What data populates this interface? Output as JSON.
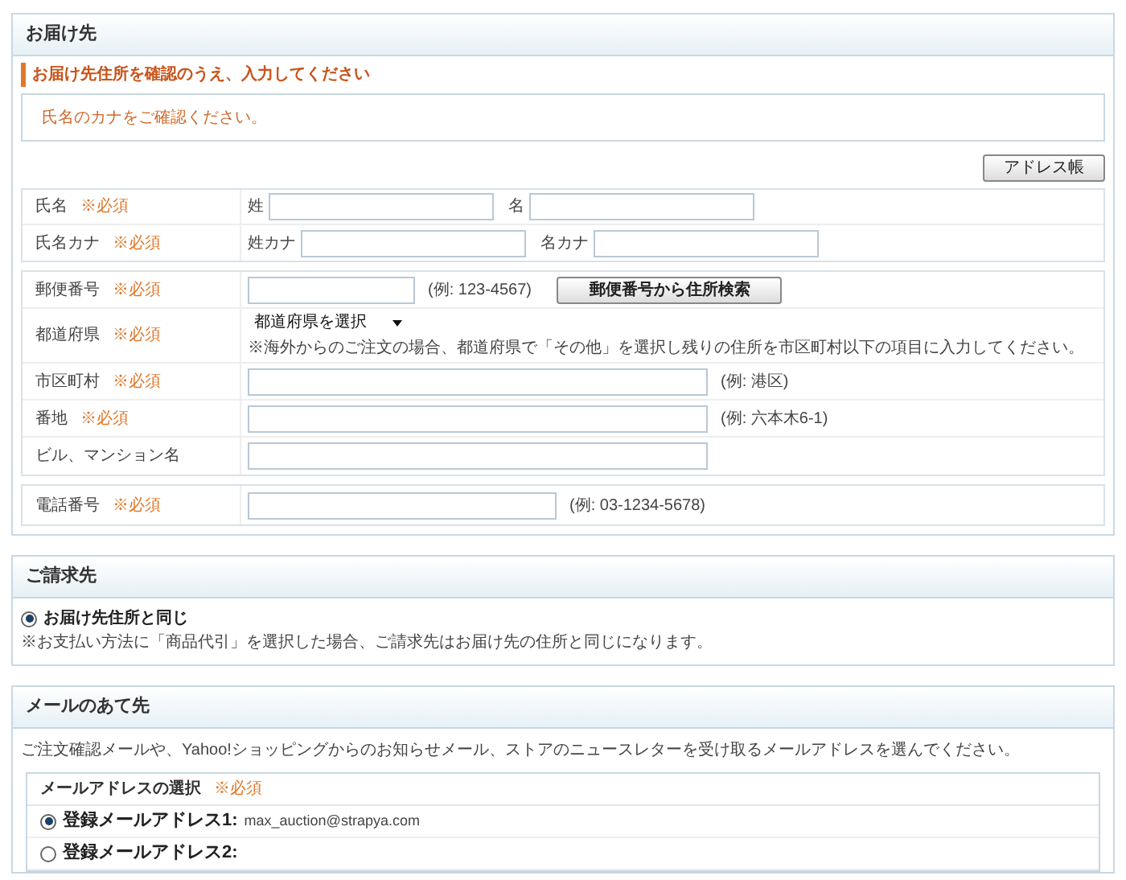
{
  "delivery": {
    "title": "お届け先",
    "instruction": "お届け先住所を確認のうえ、入力してください",
    "notice": "氏名のカナをご確認ください。",
    "address_book_button": "アドレス帳",
    "name_rows": [
      {
        "label": "氏名",
        "required": "※必須",
        "fields": [
          {
            "label": "姓"
          },
          {
            "label": "名"
          }
        ]
      },
      {
        "label": "氏名カナ",
        "required": "※必須",
        "fields": [
          {
            "label": "姓カナ"
          },
          {
            "label": "名カナ"
          }
        ]
      }
    ],
    "address_rows": [
      {
        "kind": "postal",
        "label": "郵便番号",
        "required": "※必須",
        "hint": "(例: 123-4567)",
        "button": "郵便番号から住所検索"
      },
      {
        "kind": "select",
        "label": "都道府県",
        "required": "※必須",
        "value": "都道府県を選択",
        "note": "※海外からのご注文の場合、都道府県で「その他」を選択し残りの住所を市区町村以下の項目に入力してください。"
      },
      {
        "kind": "input",
        "label": "市区町村",
        "required": "※必須",
        "hint": "(例: 港区)"
      },
      {
        "kind": "input",
        "label": "番地",
        "required": "※必須",
        "hint": "(例: 六本木6-1)"
      },
      {
        "kind": "input",
        "label": "ビル、マンション名"
      }
    ],
    "phone_row": {
      "label": "電話番号",
      "required": "※必須",
      "hint": "(例: 03-1234-5678)"
    }
  },
  "billing": {
    "title": "ご請求先",
    "option": {
      "label": "お届け先住所と同じ",
      "selected": true
    },
    "note": "※お支払い方法に「商品代引」を選択した場合、ご請求先はお届け先の住所と同じになります。"
  },
  "mail": {
    "title": "メールのあて先",
    "description": "ご注文確認メールや、Yahoo!ショッピングからのお知らせメール、ストアのニュースレターを受け取るメールアドレスを選んでください。",
    "selection_title": "メールアドレスの選択",
    "required": "※必須",
    "options": [
      {
        "label": "登録メールアドレス1:",
        "address": "max_auction@strapya.com",
        "selected": true
      },
      {
        "label": "登録メールアドレス2:",
        "selected": false
      }
    ]
  }
}
